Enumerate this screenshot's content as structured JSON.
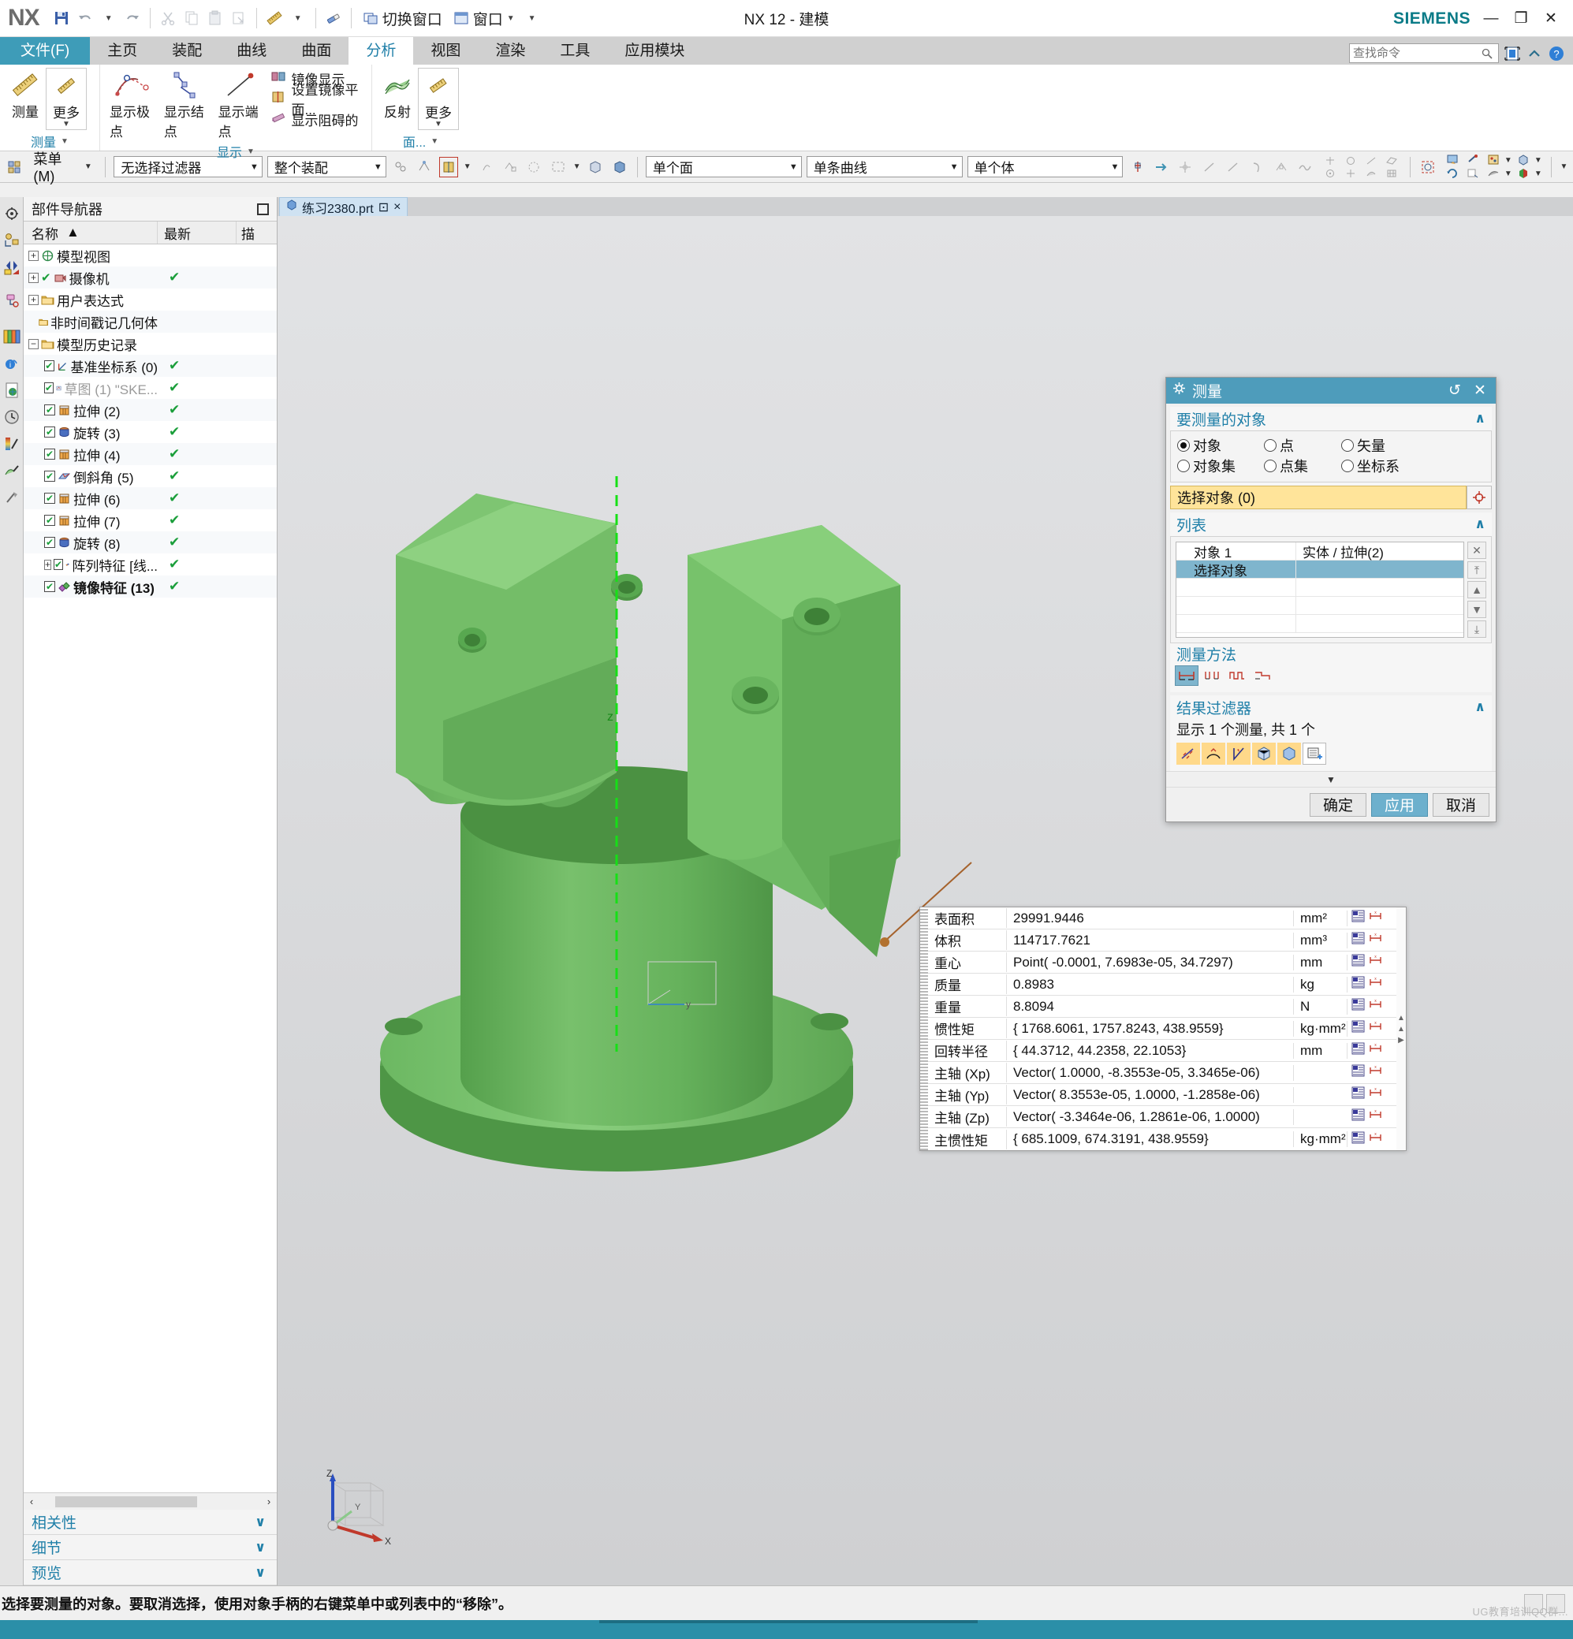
{
  "app": {
    "logo": "NX",
    "title": "NX 12 - 建模",
    "brand": "SIEMENS"
  },
  "quick_access": {
    "save": "save-icon",
    "undo": "undo-icon",
    "redo": "redo-icon",
    "cut": "cut-icon",
    "copy": "copy-icon",
    "paste": "paste-icon",
    "paste_special": "paste-special-icon",
    "measure": "measure-ruler-icon",
    "undo_style": "eraser-icon",
    "switch_window_label": "切换窗口",
    "window_label": "窗口"
  },
  "window_buttons": {
    "minimize": "—",
    "maximize": "❐",
    "close": "✕"
  },
  "tabs": [
    {
      "label": "文件(F)",
      "kind": "file"
    },
    {
      "label": "主页",
      "kind": "normal"
    },
    {
      "label": "装配",
      "kind": "normal"
    },
    {
      "label": "曲线",
      "kind": "normal"
    },
    {
      "label": "曲面",
      "kind": "normal"
    },
    {
      "label": "分析",
      "kind": "active"
    },
    {
      "label": "视图",
      "kind": "normal"
    },
    {
      "label": "渲染",
      "kind": "normal"
    },
    {
      "label": "工具",
      "kind": "normal"
    },
    {
      "label": "应用模块",
      "kind": "normal"
    }
  ],
  "search": {
    "placeholder": "查找命令",
    "value": ""
  },
  "ribbon": {
    "group_measure": {
      "label": "测量",
      "buttons": [
        {
          "label": "测量",
          "icon": "ruler-icon"
        },
        {
          "label": "更多",
          "icon": "ruler-small-icon",
          "has_dropdown": true
        }
      ]
    },
    "group_display": {
      "label": "显示",
      "buttons": [
        {
          "label": "显示极点",
          "icon": "show-poles-icon"
        },
        {
          "label": "显示结点",
          "icon": "show-knots-icon"
        },
        {
          "label": "显示端点",
          "icon": "show-endpoints-icon"
        }
      ],
      "small_items": [
        {
          "label": "镜像显示",
          "icon": "mirror-display-icon"
        },
        {
          "label": "设置镜像平面...",
          "icon": "set-mirror-plane-icon"
        },
        {
          "label": "显示阻碍的",
          "icon": "show-obstructed-icon"
        }
      ]
    },
    "group_face": {
      "label": "面...",
      "buttons": [
        {
          "label": "反射",
          "icon": "reflection-icon"
        },
        {
          "label": "更多",
          "icon": "face-more-icon",
          "has_dropdown": true
        }
      ]
    }
  },
  "selection_bar": {
    "menu_label": "菜单(M)",
    "filter_combo": "无选择过滤器",
    "scope_combo": "整个装配",
    "face_combo": "单个面",
    "curve_combo": "单条曲线",
    "body_combo": "单个体",
    "icons": [
      "select-general-icon",
      "select-feature-icon",
      "select-face-icon",
      "select-point-icon",
      "select-component-icon",
      "select-wireframe-icon",
      "select-rect-icon",
      "select-solid-icon",
      "select-body-icon"
    ]
  },
  "resource_bar": {
    "items": [
      {
        "name": "assembly-navigator-icon"
      },
      {
        "name": "constraint-navigator-icon"
      },
      {
        "name": "part-navigator-icon"
      },
      {
        "name": "reuse-library-icon"
      },
      {
        "name": "hd3d-tools-icon"
      },
      {
        "name": "web-browser-icon"
      },
      {
        "name": "history-icon"
      },
      {
        "name": "render-palette-icon"
      },
      {
        "name": "system-materials-icon"
      },
      {
        "name": "roles-icon"
      }
    ]
  },
  "part_navigator": {
    "title": "部件导航器",
    "columns": [
      "名称",
      "最新",
      "描"
    ],
    "sort_indicator": "▲",
    "rows": [
      {
        "label": "模型视图",
        "indent": 0,
        "expander": "+",
        "checkbox": false,
        "icon": "model-views-icon",
        "updated": "",
        "dim": false,
        "bold": false
      },
      {
        "label": "摄像机",
        "indent": 0,
        "expander": "+",
        "checkbox": false,
        "icon": "camera-icon",
        "updated": "✔",
        "dim": false,
        "bold": false,
        "pre_check": true
      },
      {
        "label": "用户表达式",
        "indent": 0,
        "expander": "+",
        "checkbox": false,
        "icon": "folder-icon",
        "updated": "",
        "dim": false,
        "bold": false
      },
      {
        "label": "非时间戳记几何体",
        "indent": 0,
        "expander": "",
        "checkbox": false,
        "icon": "folder-icon",
        "updated": "",
        "dim": false,
        "bold": false
      },
      {
        "label": "模型历史记录",
        "indent": 0,
        "expander": "−",
        "checkbox": false,
        "icon": "folder-icon",
        "updated": "",
        "dim": false,
        "bold": false
      },
      {
        "label": "基准坐标系 (0)",
        "indent": 1,
        "expander": "",
        "checkbox": true,
        "icon": "datum-csys-icon",
        "updated": "✔",
        "dim": false,
        "bold": false
      },
      {
        "label": "草图 (1) \"SKE...",
        "indent": 1,
        "expander": "",
        "checkbox": true,
        "icon": "sketch-icon",
        "updated": "✔",
        "dim": true,
        "bold": false
      },
      {
        "label": "拉伸 (2)",
        "indent": 1,
        "expander": "",
        "checkbox": true,
        "icon": "extrude-icon",
        "updated": "✔",
        "dim": false,
        "bold": false
      },
      {
        "label": "旋转 (3)",
        "indent": 1,
        "expander": "",
        "checkbox": true,
        "icon": "revolve-icon",
        "updated": "✔",
        "dim": false,
        "bold": false
      },
      {
        "label": "拉伸 (4)",
        "indent": 1,
        "expander": "",
        "checkbox": true,
        "icon": "extrude-icon",
        "updated": "✔",
        "dim": false,
        "bold": false
      },
      {
        "label": "倒斜角 (5)",
        "indent": 1,
        "expander": "",
        "checkbox": true,
        "icon": "chamfer-icon",
        "updated": "✔",
        "dim": false,
        "bold": false
      },
      {
        "label": "拉伸 (6)",
        "indent": 1,
        "expander": "",
        "checkbox": true,
        "icon": "extrude-icon",
        "updated": "✔",
        "dim": false,
        "bold": false
      },
      {
        "label": "拉伸 (7)",
        "indent": 1,
        "expander": "",
        "checkbox": true,
        "icon": "extrude-icon",
        "updated": "✔",
        "dim": false,
        "bold": false
      },
      {
        "label": "旋转 (8)",
        "indent": 1,
        "expander": "",
        "checkbox": true,
        "icon": "revolve-icon",
        "updated": "✔",
        "dim": false,
        "bold": false
      },
      {
        "label": "阵列特征 [线...",
        "indent": 1,
        "expander": "+",
        "checkbox": true,
        "icon": "pattern-feature-icon",
        "updated": "✔",
        "dim": false,
        "bold": false
      },
      {
        "label": "镜像特征 (13)",
        "indent": 1,
        "expander": "",
        "checkbox": true,
        "icon": "mirror-feature-icon",
        "updated": "✔",
        "dim": false,
        "bold": true
      }
    ],
    "collapsers": [
      {
        "label": "相关性",
        "chevron": "∨"
      },
      {
        "label": "细节",
        "chevron": "∨"
      },
      {
        "label": "预览",
        "chevron": "∨"
      }
    ]
  },
  "part_tab": {
    "label": "练习2380.prt",
    "modified_marker": "⊡",
    "close": "×"
  },
  "measure_dialog": {
    "title": "测量",
    "reset_icon": "reset-icon",
    "close_icon": "close-icon",
    "section_objects": {
      "title": "要测量的对象",
      "radios": [
        {
          "label": "对象",
          "selected": true
        },
        {
          "label": "点",
          "selected": false
        },
        {
          "label": "矢量",
          "selected": false
        },
        {
          "label": "对象集",
          "selected": false
        },
        {
          "label": "点集",
          "selected": false
        },
        {
          "label": "坐标系",
          "selected": false
        }
      ],
      "select_field": "选择对象 (0)",
      "select_button_icon": "target-select-icon"
    },
    "section_list": {
      "title": "列表",
      "rows": [
        {
          "c1": "对象 1",
          "c2": "实体 / 拉伸(2)",
          "selected": false
        },
        {
          "c1": "选择对象",
          "c2": "",
          "selected": true
        },
        {
          "c1": "",
          "c2": "",
          "selected": false
        },
        {
          "c1": "",
          "c2": "",
          "selected": false
        },
        {
          "c1": "",
          "c2": "",
          "selected": false
        }
      ],
      "side_buttons": [
        "delete-icon",
        "move-top-icon",
        "move-up-icon",
        "move-down-icon",
        "move-bottom-icon"
      ]
    },
    "section_method": {
      "title": "测量方法",
      "buttons": [
        {
          "icon": "method-minimum-icon",
          "active": true
        },
        {
          "icon": "method-parts-icon",
          "active": false
        },
        {
          "icon": "method-steps-icon",
          "active": false
        },
        {
          "icon": "method-mixed-icon",
          "active": false
        }
      ]
    },
    "section_filter": {
      "title": "结果过滤器",
      "count_text": "显示 1 个测量, 共 1 个",
      "buttons": [
        {
          "icon": "filter-length-icon",
          "active": true
        },
        {
          "icon": "filter-radius-icon",
          "active": true
        },
        {
          "icon": "filter-angle-icon",
          "active": true
        },
        {
          "icon": "filter-body-icon",
          "active": true
        },
        {
          "icon": "filter-volume-icon",
          "active": true
        },
        {
          "icon": "filter-add-icon",
          "active": false
        }
      ]
    },
    "more_chevron": "▼",
    "footer": {
      "ok": "确定",
      "apply": "应用",
      "cancel": "取消"
    }
  },
  "results": {
    "rows": [
      {
        "label": "表面积",
        "value": "29991.9446",
        "unit": "mm²"
      },
      {
        "label": "体积",
        "value": "114717.7621",
        "unit": "mm³"
      },
      {
        "label": "重心",
        "value": "Point( -0.0001, 7.6983e-05, 34.7297)",
        "unit": "mm"
      },
      {
        "label": "质量",
        "value": "0.8983",
        "unit": "kg"
      },
      {
        "label": "重量",
        "value": "8.8094",
        "unit": "N"
      },
      {
        "label": "惯性矩",
        "value": "{ 1768.6061, 1757.8243, 438.9559}",
        "unit": "kg·mm²"
      },
      {
        "label": "回转半径",
        "value": "{ 44.3712, 44.2358, 22.1053}",
        "unit": "mm"
      },
      {
        "label": "主轴 (Xp)",
        "value": "Vector( 1.0000, -8.3553e-05, 3.3465e-06)",
        "unit": ""
      },
      {
        "label": "主轴 (Yp)",
        "value": "Vector( 8.3553e-05, 1.0000, -1.2858e-06)",
        "unit": ""
      },
      {
        "label": "主轴 (Zp)",
        "value": "Vector( -3.3464e-06, 1.2861e-06, 1.0000)",
        "unit": ""
      },
      {
        "label": "主惯性矩",
        "value": "{ 685.1009, 674.3191, 438.9559}",
        "unit": "kg·mm²"
      }
    ],
    "row_icons": [
      "expression-icon",
      "dimension-icon"
    ]
  },
  "graphics": {
    "model_color": "#6cbf63",
    "axis_label_z": "z",
    "triad": {
      "x": "X",
      "y": "Y",
      "z": "Z"
    }
  },
  "status_bar": {
    "message": "选择要测量的对象。要取消选择，使用对象手柄的右键菜单中或列表中的“移除”。"
  },
  "watermark": "UG教育培训QQ群..."
}
